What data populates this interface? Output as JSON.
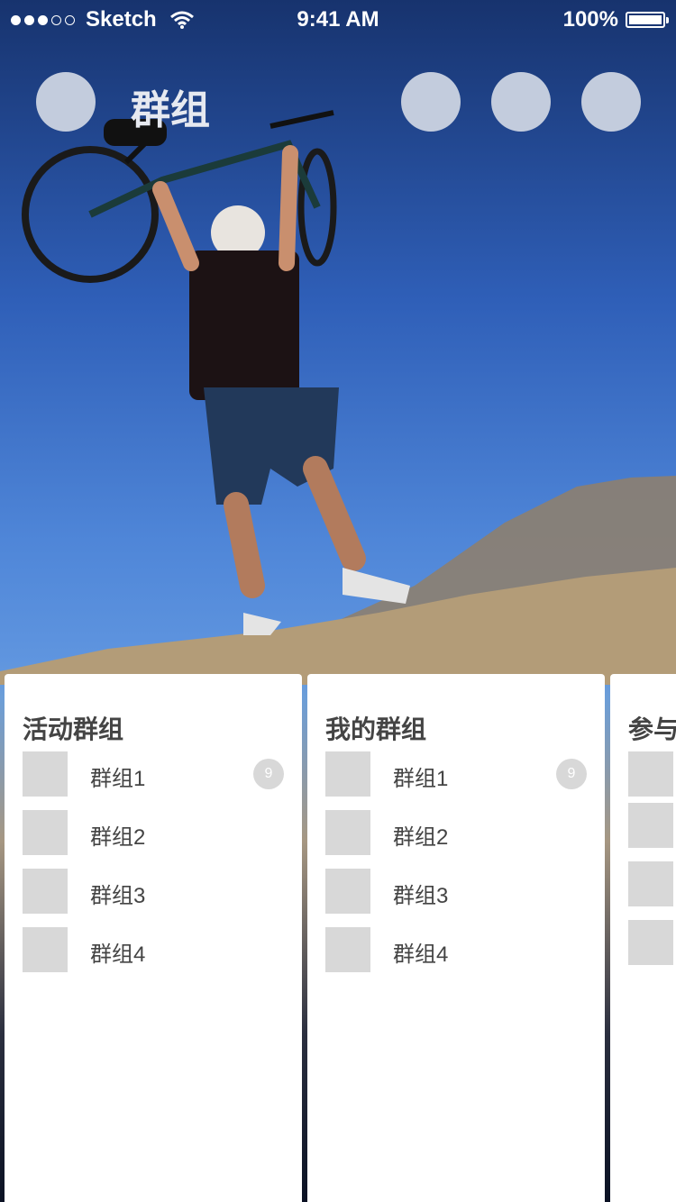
{
  "status_bar": {
    "carrier": "Sketch",
    "time": "9:41 AM",
    "battery": "100%",
    "signal_icon": "signal-dots-icon",
    "wifi_icon": "wifi-icon",
    "battery_icon": "battery-icon"
  },
  "header": {
    "title": "群组"
  },
  "cards": [
    {
      "title": "活动群组",
      "items": [
        {
          "label": "群组1",
          "badge": "9"
        },
        {
          "label": "群组2"
        },
        {
          "label": "群组3"
        },
        {
          "label": "群组4"
        }
      ]
    },
    {
      "title": "我的群组",
      "items": [
        {
          "label": "群组1",
          "badge": "9"
        },
        {
          "label": "群组2"
        },
        {
          "label": "群组3"
        },
        {
          "label": "群组4"
        }
      ]
    },
    {
      "title": "参与"
    }
  ],
  "colors": {
    "card_bg": "#ffffff",
    "placeholder": "#d8d8d8",
    "header_circle": "#c3ccdd",
    "text": "#444444"
  }
}
